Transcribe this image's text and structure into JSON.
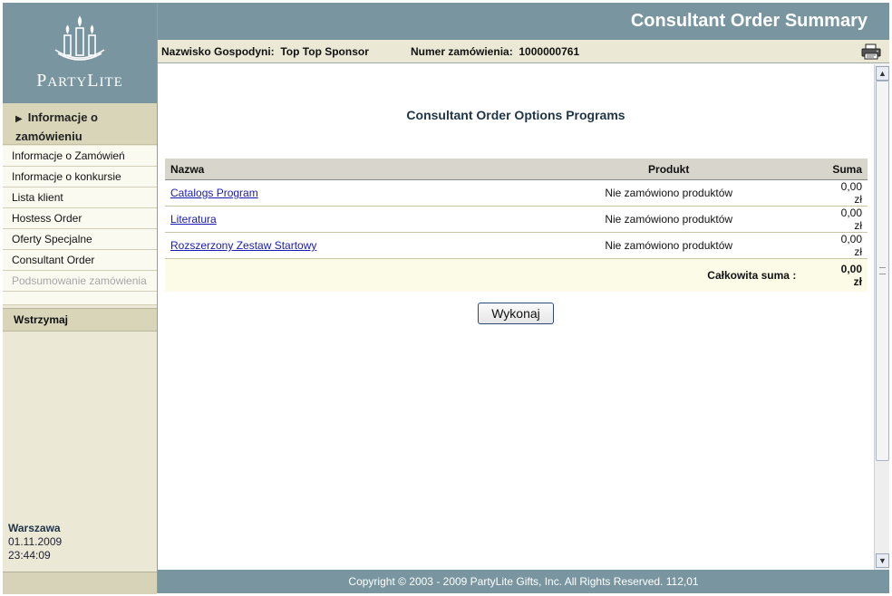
{
  "header": {
    "title": "Consultant Order Summary"
  },
  "info": {
    "host_label": "Nazwisko Gospodyni:",
    "host_value": "Top Top Sponsor",
    "order_label": "Numer zamówienia:",
    "order_value": "1000000761"
  },
  "brand": {
    "name_first": "P",
    "name_rest1": "ARTY",
    "name_mid": "L",
    "name_rest2": "ITE"
  },
  "sidebar": {
    "section": "Informacje o zamówieniu",
    "items": [
      {
        "label": "Informacje o Zamówień",
        "enabled": true
      },
      {
        "label": "Informacje o konkursie",
        "enabled": true
      },
      {
        "label": "Lista klient",
        "enabled": true
      },
      {
        "label": "Hostess Order",
        "enabled": true
      },
      {
        "label": "Oferty Specjalne",
        "enabled": true
      },
      {
        "label": "Consultant Order",
        "enabled": true
      },
      {
        "label": "Podsumowanie zamówienia",
        "enabled": false
      }
    ],
    "hold": "Wstrzymaj",
    "city": "Warszawa",
    "date": "01.11.2009",
    "time": "23:44:09"
  },
  "main": {
    "heading": "Consultant Order Options Programs",
    "columns": {
      "name": "Nazwa",
      "product": "Produkt",
      "sum": "Suma"
    },
    "rows": [
      {
        "name": "Catalogs Program",
        "product": "Nie zamówiono produktów",
        "sum": "0,00 zł"
      },
      {
        "name": "Literatura",
        "product": "Nie zamówiono produktów",
        "sum": "0,00 zł"
      },
      {
        "name": "Rozszerzony Zestaw Startowy",
        "product": "Nie zamówiono produktów",
        "sum": "0,00 zł"
      }
    ],
    "total_label": "Całkowita suma :",
    "total_value": "0,00 zł",
    "submit": "Wykonaj"
  },
  "footer": {
    "text": "Copyright © 2003 - 2009 PartyLite Gifts, Inc. All Rights Reserved.  112,01"
  },
  "colors": {
    "header_bg": "#7996a0",
    "sidebar_bg": "#ebe9d6",
    "link": "#1a1ab4",
    "heading": "#1f3447"
  },
  "icons": {
    "print": "printer-icon",
    "logo": "candles-logo-icon",
    "section": "triangle-right-icon"
  }
}
